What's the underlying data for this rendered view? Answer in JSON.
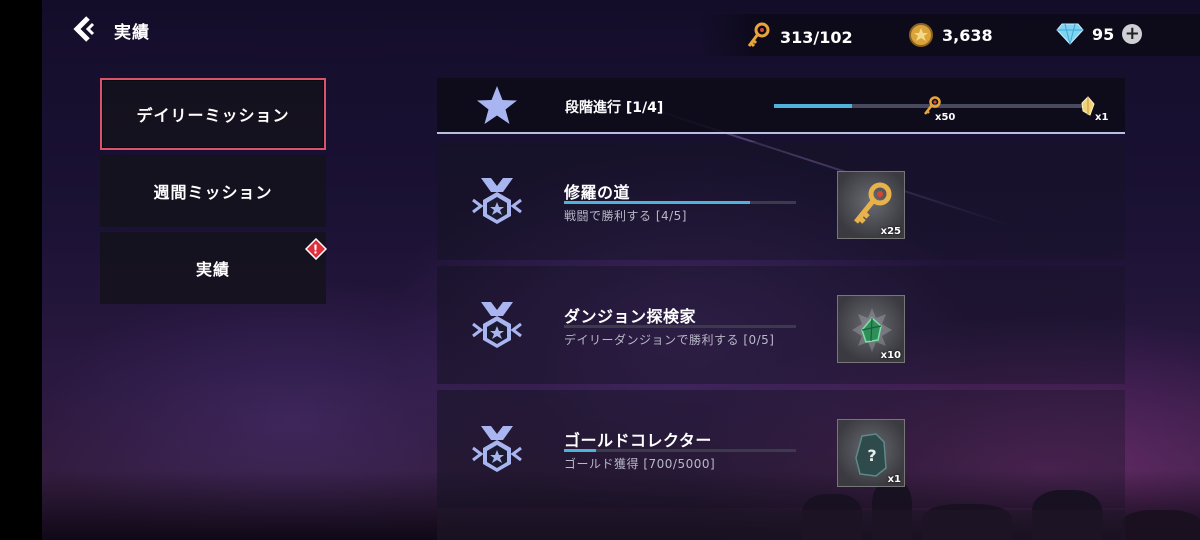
{
  "header": {
    "title": "実績",
    "back_icon": "chevron-left-icon"
  },
  "currencies": {
    "keys": {
      "icon": "key-icon",
      "value": "313/102"
    },
    "gold": {
      "icon": "gold-coin-icon",
      "value": "3,638"
    },
    "gems": {
      "icon": "diamond-icon",
      "value": "95",
      "plus_label": "+"
    }
  },
  "tabs": [
    {
      "label": "デイリーミッション",
      "active": true
    },
    {
      "label": "週間ミッション",
      "active": false
    },
    {
      "label": "実績",
      "active": false,
      "alert": "!"
    }
  ],
  "stage": {
    "label": "段階進行 [1/4]",
    "progress": 0.25,
    "milestones": [
      {
        "icon": "key-icon",
        "qty": "x50"
      },
      {
        "icon": "crystal-icon",
        "qty": "x1"
      }
    ]
  },
  "missions": [
    {
      "title": "修羅の道",
      "desc": "戦闘で勝利する [4/5]",
      "progress": 0.8,
      "reward": {
        "icon": "key-icon",
        "qty": "x25"
      }
    },
    {
      "title": "ダンジョン探検家",
      "desc": "デイリーダンジョンで勝利する [0/5]",
      "progress": 0.0,
      "reward": {
        "icon": "green-crystal-icon",
        "qty": "x10"
      }
    },
    {
      "title": "ゴールドコレクター",
      "desc": "ゴールド獲得 [700/5000]",
      "progress": 0.14,
      "reward": {
        "icon": "mystery-box-icon",
        "qty": "x1"
      }
    }
  ],
  "colors": {
    "accent": "#4fb3d9",
    "active_tab_border": "#d9536b",
    "alert": "#e02d3c"
  }
}
